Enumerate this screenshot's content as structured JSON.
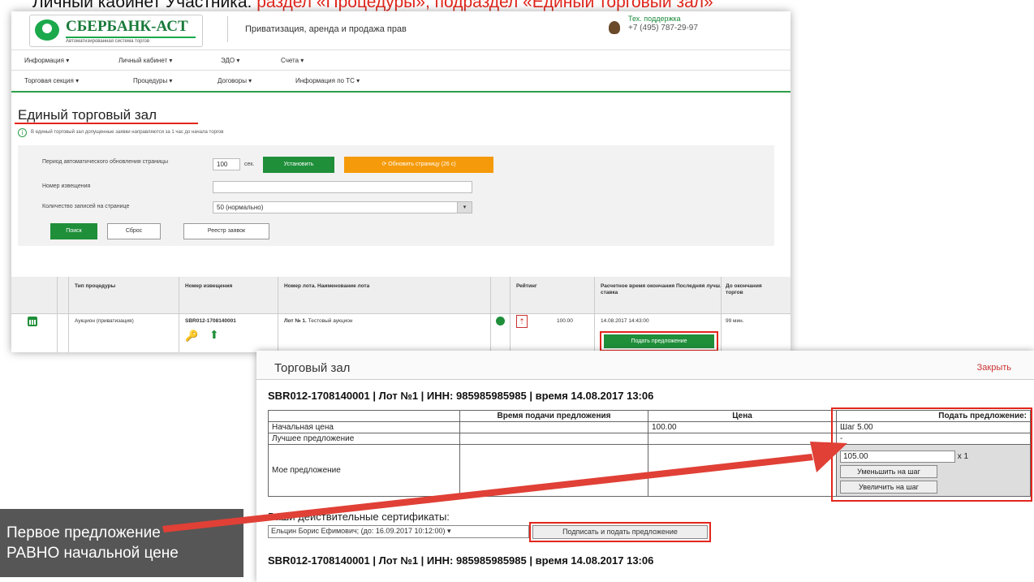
{
  "slide": {
    "title_black": "Личный кабинет Участника: ",
    "title_red": "раздел «Процедуры», подраздел «Единый торговый зал»",
    "callout_line1": "Первое предложение",
    "callout_line2": "РАВНО начальной цене"
  },
  "header": {
    "logo_name": "СБЕРБАНК-АСТ",
    "logo_subtitle": "Автоматизированная система торгов",
    "title": "Приватизация, аренда и продажа прав",
    "support_label": "Тех. поддержка",
    "support_phone": "+7 (495) 787-29-97"
  },
  "nav1": [
    "Информация ▾",
    "Личный кабинет ▾",
    "ЭДО ▾",
    "Счета ▾"
  ],
  "nav2": [
    "Торговая секция ▾",
    "Процедуры ▾",
    "Договоры ▾",
    "Информация по ТС ▾"
  ],
  "page": {
    "heading": "Единый торговый зал",
    "info": "В единый торговый зал допущенные заявки направляются за 1 час до начала торгов"
  },
  "filter": {
    "refresh_label": "Период автоматического обновления страницы",
    "refresh_value": "100",
    "refresh_unit": "сек.",
    "set_button": "Установить",
    "refresh_button": "Обновить страницу (26 с)",
    "notice_label": "Номер извещения",
    "notice_value": "",
    "per_page_label": "Количество записей на странице",
    "per_page_value": "50 (нормально)",
    "search_button": "Поиск",
    "reset_button": "Сброс",
    "registry_button": "Реестр заявок"
  },
  "grid": {
    "headers": {
      "type": "Тип процедуры",
      "notice": "Номер извещения",
      "lot": "Номер лота. Наименование лота",
      "rating": "Рейтинг",
      "end_time": "Расчетное время окончания Последняя лучш. ставка",
      "remaining": "До окончания торгов"
    },
    "row": {
      "type": "Аукцион (приватизация)",
      "notice": "SBR012-1708140001",
      "lot_bold": "Лот № 1.",
      "lot_name": "Тестовый аукцион",
      "price": "100.00",
      "end_time": "14.08.2017 14:43:00",
      "remaining": "99 мин.",
      "offer_button": "Подать предложение"
    }
  },
  "trade": {
    "title": "Торговый зал",
    "close": "Закрыть",
    "lot_header": "SBR012-1708140001 | Лот №1 | ИНН: 985985985985 | время 14.08.2017 13:06",
    "col_time": "Время подачи предложения",
    "col_price": "Цена",
    "col_offer": "Подать предложение:",
    "row1_label": "Начальная цена",
    "row1_price": "100.00",
    "row1_offer": "Шаг 5.00",
    "row2_label": "Лучшее предложение",
    "row2_offer": "-",
    "row3_label": "Мое предложение",
    "my_value": "105.00",
    "multiplier": "x 1",
    "decrease_button": "Уменьшить на шаг",
    "increase_button": "Увеличить на шаг",
    "cert_label": "Ваши действительные сертификаты:",
    "cert_value": "Ельцин Борис Ефимович; (до: 16.09.2017 10:12:00)",
    "sign_button": "Подписать и подать предложение"
  }
}
